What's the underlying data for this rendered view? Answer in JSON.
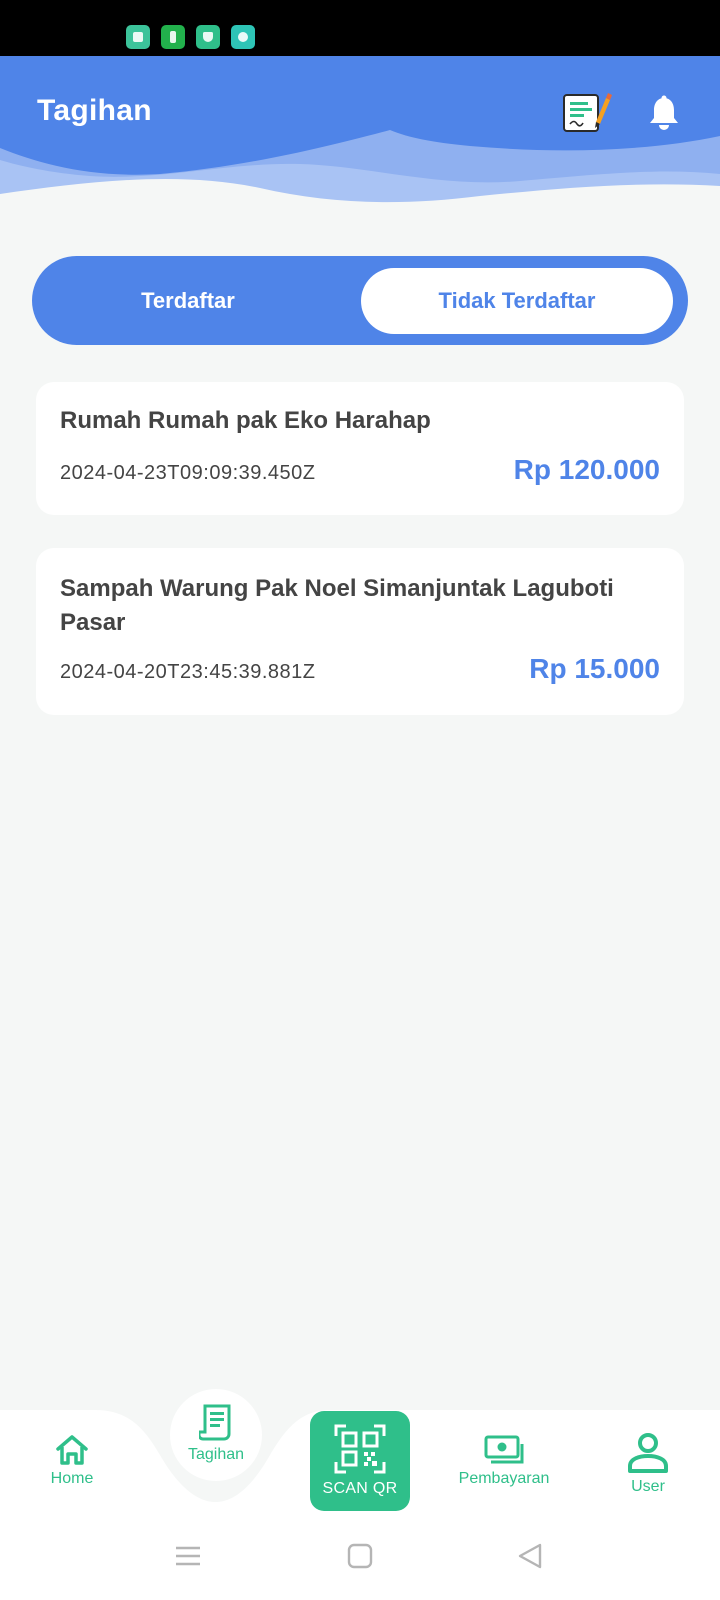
{
  "status_bar": {
    "icons": [
      {
        "name": "gallery-notification-icon",
        "color": "#3cc39a"
      },
      {
        "name": "app-notification-icon",
        "color": "#22b14c"
      },
      {
        "name": "shield-notification-icon",
        "color": "#2fbf8a"
      },
      {
        "name": "settings-notification-icon",
        "color": "#2ec4b6"
      }
    ]
  },
  "header": {
    "title": "Tagihan",
    "actions": [
      "report-icon",
      "bell-icon"
    ]
  },
  "tabs": {
    "registered": "Terdaftar",
    "unregistered": "Tidak Terdaftar",
    "active": "unregistered"
  },
  "bills": [
    {
      "title": "Rumah Rumah pak Eko Harahap",
      "date": "2024-04-23T09:09:39.450Z",
      "amount": "Rp 120.000"
    },
    {
      "title": "Sampah Warung Pak Noel Simanjuntak Laguboti Pasar",
      "date": "2024-04-20T23:45:39.881Z",
      "amount": "Rp 15.000"
    }
  ],
  "bottom_nav": {
    "home": "Home",
    "tagihan": "Tagihan",
    "scan": "SCAN QR",
    "pembayaran": "Pembayaran",
    "user": "User",
    "active": "tagihan"
  },
  "colors": {
    "primary_blue": "#4f84e8",
    "accent_green": "#2fbf8a",
    "background": "#f5f7f6"
  }
}
